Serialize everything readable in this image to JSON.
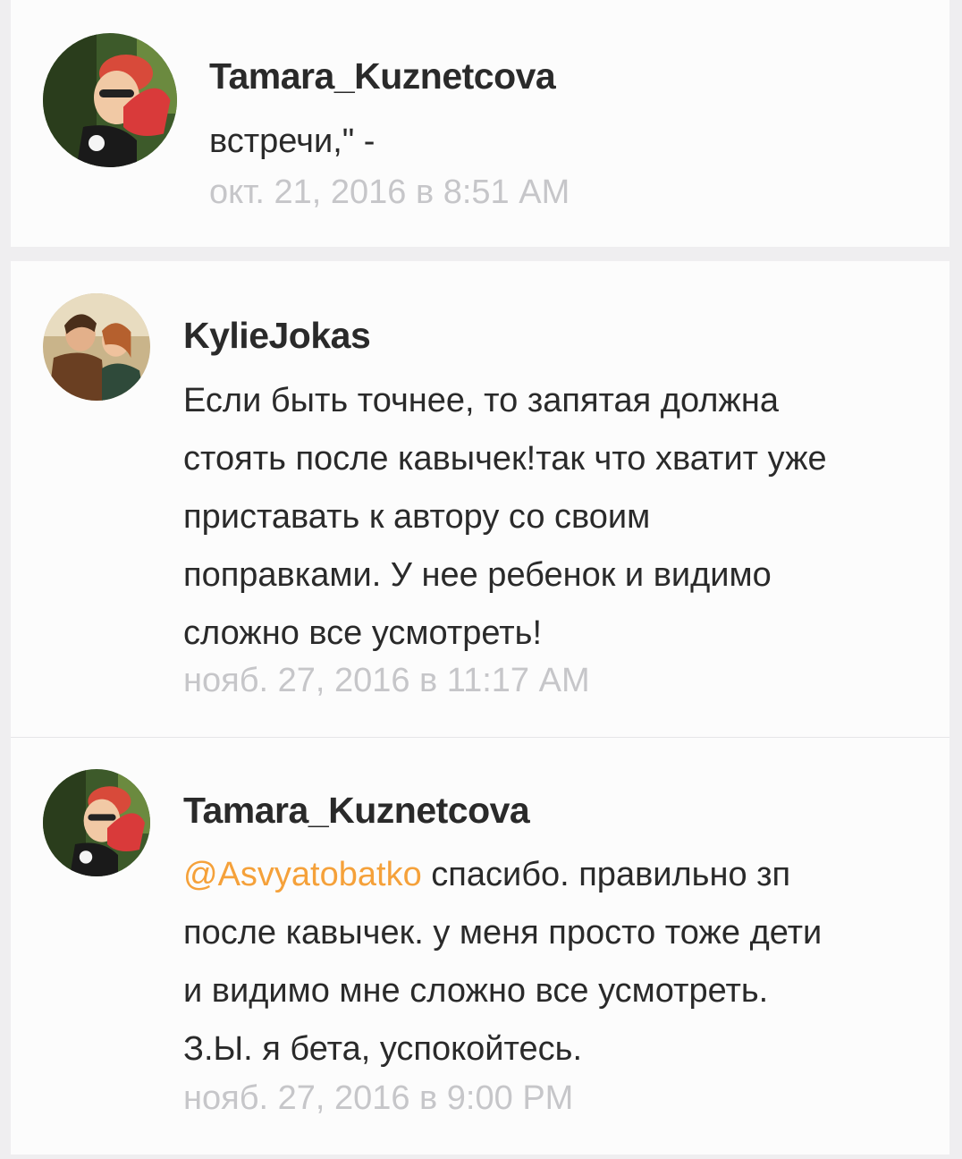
{
  "comments": [
    {
      "author": "Tamara_Kuznetcova",
      "avatar": "avatar-tamara",
      "lines": [
        "встречи,\" -"
      ],
      "timestamp": "окт. 21, 2016 в 8:51 AM"
    },
    {
      "author": "KylieJokas",
      "avatar": "avatar-kylie",
      "lines": [
        "Если быть точнее, то запятая должна",
        "стоять после кавычек!так что хватит уже",
        "приставать к автору со своим",
        "поправками. У нее ребенок и видимо",
        "сложно все усмотреть!"
      ],
      "timestamp": "нояб. 27, 2016 в 11:17 AM"
    },
    {
      "author": "Tamara_Kuznetcova",
      "avatar": "avatar-tamara",
      "mention": "@Asvyatobatko",
      "first_line_rest": " спасибо. правильно зп",
      "lines": [
        "после кавычек. у меня просто тоже дети",
        "и видимо мне сложно все усмотреть.",
        "З.Ы. я бета, успокойтесь."
      ],
      "timestamp": "нояб. 27, 2016 в 9:00 PM"
    }
  ],
  "colors": {
    "background": "#efeef0",
    "card": "#fcfcfc",
    "text": "#2a2a2a",
    "timestamp": "#c6c6c9",
    "mention": "#f5a13a"
  }
}
